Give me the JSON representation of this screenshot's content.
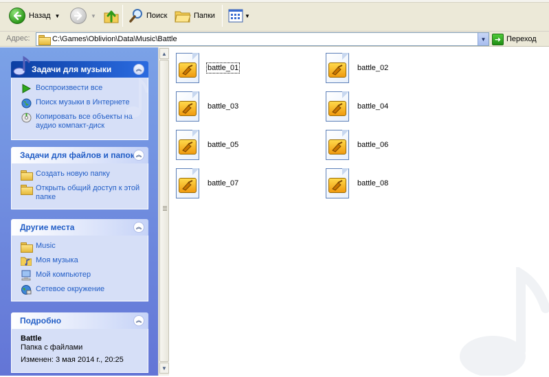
{
  "toolbar": {
    "back_label": "Назад",
    "search_label": "Поиск",
    "folders_label": "Папки"
  },
  "address": {
    "label": "Адрес:",
    "path": "C:\\Games\\Oblivion\\Data\\Music\\Battle",
    "go_label": "Переход"
  },
  "music_tasks": {
    "title": "Задачи для музыки",
    "items": [
      {
        "label": "Воспроизвести все",
        "icon": "play-icon"
      },
      {
        "label": "Поиск музыки в Интернете",
        "icon": "globe-icon"
      },
      {
        "label": "Копировать все объекты на аудио компакт-диск",
        "icon": "cd-copy-icon"
      }
    ]
  },
  "file_tasks": {
    "title": "Задачи для файлов и папок",
    "items": [
      {
        "label": "Создать новую папку",
        "icon": "new-folder-icon"
      },
      {
        "label": "Открыть общий доступ к этой папке",
        "icon": "shared-folder-icon"
      }
    ]
  },
  "other_places": {
    "title": "Другие места",
    "items": [
      {
        "label": "Music",
        "icon": "folder-icon"
      },
      {
        "label": "Моя музыка",
        "icon": "my-music-icon"
      },
      {
        "label": "Мой компьютер",
        "icon": "computer-icon"
      },
      {
        "label": "Сетевое окружение",
        "icon": "network-icon"
      }
    ]
  },
  "details": {
    "title": "Подробно",
    "name": "Battle",
    "type": "Папка с файлами",
    "modified": "Изменен: 3 мая 2014 г., 20:25"
  },
  "files": [
    {
      "name": "battle_01",
      "focused": true
    },
    {
      "name": "battle_02"
    },
    {
      "name": "battle_03"
    },
    {
      "name": "battle_04"
    },
    {
      "name": "battle_05"
    },
    {
      "name": "battle_06"
    },
    {
      "name": "battle_07"
    },
    {
      "name": "battle_08"
    }
  ],
  "colors": {
    "left_pane_gradient": [
      "#7ba2e7",
      "#6375d6"
    ],
    "panel_body": "#d6dff7",
    "link": "#215dc6",
    "special_header": "#0c3fa3"
  }
}
